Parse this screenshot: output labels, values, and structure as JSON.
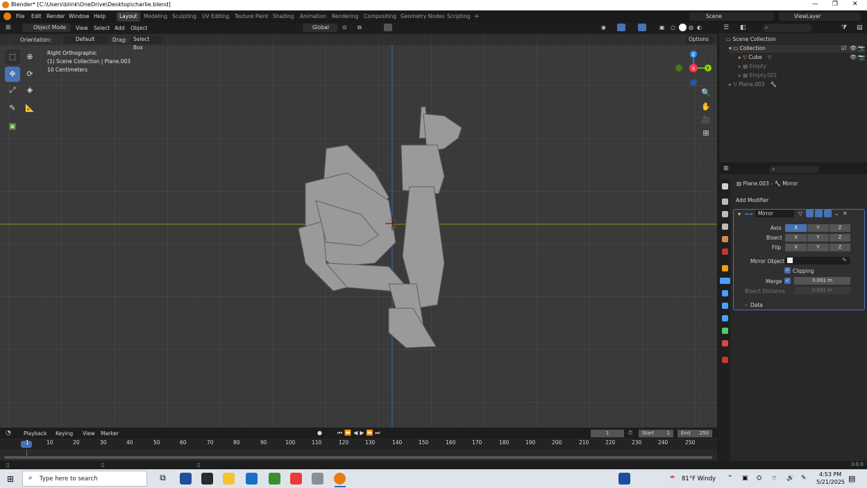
{
  "window": {
    "title": "Blender* [C:\\Users\\blink\\OneDrive\\Desktop\\charlie.blend]",
    "min": "—",
    "max": "❐",
    "close": "✕"
  },
  "menu": {
    "file": "File",
    "edit": "Edit",
    "render": "Render",
    "window": "Window",
    "help": "Help"
  },
  "workspaces": [
    "Layout",
    "Modeling",
    "Sculpting",
    "UV Editing",
    "Texture Paint",
    "Shading",
    "Animation",
    "Rendering",
    "Compositing",
    "Geometry Nodes",
    "Scripting",
    "+"
  ],
  "scene": {
    "name": "Scene",
    "view_layer": "ViewLayer"
  },
  "viewport_header": {
    "mode": "Object Mode",
    "view": "View",
    "select": "Select",
    "add": "Add",
    "object": "Object",
    "transform": "Global"
  },
  "tool_header": {
    "orientation_label": "Orientation:",
    "orientation": "Default",
    "drag_label": "Drag:",
    "drag": "Select Box",
    "options": "Options"
  },
  "viewport": {
    "view_name": "Right Orthographic",
    "collection": "(1) Scene Collection | Plane.003",
    "scale": "10 Centimeters"
  },
  "gizmo": {
    "z": "Z",
    "y": "Y",
    "x": "X"
  },
  "outliner": {
    "root": "Scene Collection",
    "items": [
      {
        "name": "Collection",
        "indent": 1
      },
      {
        "name": "Cube",
        "indent": 2
      },
      {
        "name": "Empty",
        "indent": 2
      },
      {
        "name": "Empty.001",
        "indent": 2
      },
      {
        "name": "Plane.003",
        "indent": 1
      }
    ]
  },
  "properties": {
    "breadcrumb_object": "Plane.003",
    "breadcrumb_mod": "Mirror",
    "add_modifier": "Add Modifier",
    "modifier_name": "Mirror",
    "axis_label": "Axis",
    "bisect_label": "Bisect",
    "flip_label": "Flip",
    "x": "X",
    "y": "Y",
    "z": "Z",
    "mirror_object_label": "Mirror Object",
    "clipping_label": "Clipping",
    "merge_label": "Merge",
    "merge_value": "0.001 m",
    "bisect_distance_label": "Bisect Distance",
    "bisect_distance_value": "0.001 m",
    "data_label": "Data"
  },
  "timeline": {
    "playback": "Playback",
    "keying": "Keying",
    "view": "View",
    "marker": "Marker",
    "current_frame": "1",
    "start_label": "Start",
    "start": "1",
    "end_label": "End",
    "end": "250",
    "ruler": [
      "1",
      "10",
      "20",
      "30",
      "40",
      "50",
      "60",
      "70",
      "80",
      "90",
      "100",
      "110",
      "120",
      "130",
      "140",
      "150",
      "160",
      "170",
      "180",
      "190",
      "200",
      "210",
      "220",
      "230",
      "240",
      "250"
    ]
  },
  "status": {
    "version": "3.0.0"
  },
  "taskbar": {
    "search_placeholder": "Type here to search",
    "weather": "81°F  Windy",
    "time": "4:53 PM",
    "date": "5/21/2025"
  },
  "colors": {
    "accent": "#4772b3",
    "x_axis": "#ff3352",
    "y_axis": "#8bdc00",
    "z_axis": "#2890ff"
  }
}
